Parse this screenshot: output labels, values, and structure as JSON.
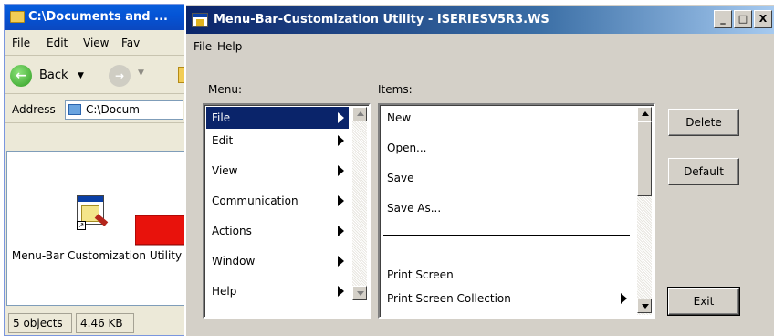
{
  "explorer": {
    "title": "C:\\Documents and ...",
    "menus": [
      "File",
      "Edit",
      "View",
      "Fav"
    ],
    "back_label": "Back",
    "address_label": "Address",
    "address_value": "C:\\Docum",
    "shortcut_label": "Menu-Bar Customization Utility",
    "status_objects": "5 objects",
    "status_size": "4.46 KB"
  },
  "utility": {
    "title": "Menu-Bar-Customization Utility - ISERIESV5R3.WS",
    "menus": [
      "File",
      "Help"
    ],
    "menu_list_label": "Menu:",
    "items_list_label": "Items:",
    "menu_list": [
      {
        "label": "File",
        "selected": true,
        "has_submenu": true
      },
      {
        "label": "Edit",
        "selected": false,
        "has_submenu": true
      },
      {
        "label": "View",
        "selected": false,
        "has_submenu": true
      },
      {
        "label": "Communication",
        "selected": false,
        "has_submenu": true
      },
      {
        "label": "Actions",
        "selected": false,
        "has_submenu": true
      },
      {
        "label": "Window",
        "selected": false,
        "has_submenu": true
      },
      {
        "label": "Help",
        "selected": false,
        "has_submenu": true
      }
    ],
    "items_list": [
      {
        "label": "New"
      },
      {
        "label": "Open..."
      },
      {
        "label": "Save"
      },
      {
        "label": "Save As..."
      },
      {
        "label": "",
        "separator": true
      },
      {
        "label": "Print Screen"
      },
      {
        "label": "Print Screen Collection",
        "has_submenu": true
      }
    ],
    "buttons": {
      "delete": "Delete",
      "default": "Default",
      "exit": "Exit"
    }
  },
  "colors": {
    "xp_title_blue": "#0454d6",
    "classic_title_start": "#0a246a",
    "classic_title_end": "#a6caf0",
    "selection": "#0a246a",
    "dialog_face": "#d4d0c8",
    "callout_red": "#e8120c"
  }
}
